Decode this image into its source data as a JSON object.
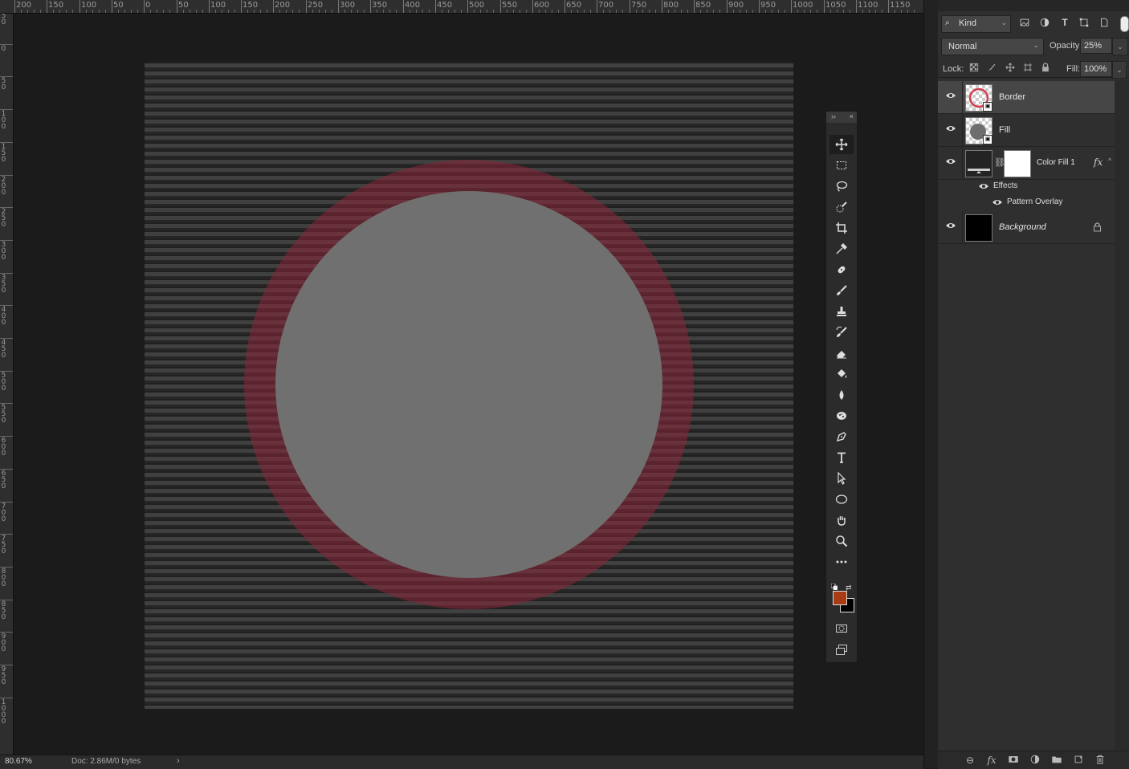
{
  "ruler": {
    "top_labels": [
      "200",
      "150",
      "100",
      "50",
      "0",
      "50",
      "100",
      "150",
      "200",
      "250",
      "300",
      "350",
      "400",
      "450",
      "500",
      "550",
      "600",
      "650",
      "700",
      "750",
      "800",
      "850",
      "900",
      "950",
      "1000",
      "1050",
      "1100",
      "1150"
    ],
    "left_labels": [
      "5\n0",
      "0",
      "5\n0",
      "1\n0\n0",
      "1\n5\n0",
      "2\n0\n0",
      "2\n5\n0",
      "3\n0\n0",
      "3\n5\n0",
      "4\n0\n0",
      "4\n5\n0",
      "5\n0\n0",
      "5\n5\n0",
      "6\n0\n0",
      "6\n5\n0",
      "7\n0\n0",
      "7\n5\n0",
      "8\n0\n0",
      "8\n5\n0",
      "9\n0\n0",
      "9\n5\n0",
      "1\n0\n0\n0"
    ]
  },
  "status": {
    "zoom": "80.67%",
    "doc_info": "Doc: 2.86M/0 bytes",
    "arrow": "›"
  },
  "tools": {
    "header_collapse": "››",
    "header_close": "×",
    "items": [
      {
        "name": "move-tool",
        "icon": "move-icon",
        "active": true
      },
      {
        "name": "rectangular-marquee-tool",
        "icon": "marquee-icon"
      },
      {
        "name": "lasso-tool",
        "icon": "lasso-icon"
      },
      {
        "name": "quick-selection-tool",
        "icon": "quick-selection-icon"
      },
      {
        "name": "crop-tool",
        "icon": "crop-icon"
      },
      {
        "name": "eyedropper-tool",
        "icon": "eyedropper-icon"
      },
      {
        "name": "healing-brush-tool",
        "icon": "bandage-icon"
      },
      {
        "name": "brush-tool",
        "icon": "brush-icon"
      },
      {
        "name": "clone-stamp-tool",
        "icon": "stamp-icon"
      },
      {
        "name": "history-brush-tool",
        "icon": "history-brush-icon"
      },
      {
        "name": "eraser-tool",
        "icon": "eraser-icon"
      },
      {
        "name": "paint-bucket-tool",
        "icon": "paint-bucket-icon"
      },
      {
        "name": "blur-tool",
        "icon": "drop-icon"
      },
      {
        "name": "dodge-tool",
        "icon": "sponge-icon"
      },
      {
        "name": "pen-tool",
        "icon": "pen-icon"
      },
      {
        "name": "type-tool",
        "icon": "type-icon"
      },
      {
        "name": "path-selection-tool",
        "icon": "arrow-icon"
      },
      {
        "name": "ellipse-tool",
        "icon": "ellipse-icon"
      },
      {
        "name": "hand-tool",
        "icon": "hand-icon"
      },
      {
        "name": "zoom-tool",
        "icon": "zoom-icon"
      },
      {
        "name": "edit-toolbar",
        "icon": "more-icon"
      }
    ],
    "foreground_color": "#a83c14",
    "background_color": "#000000",
    "quick_mask_icon": "quick-mask-icon",
    "screen_mode_icon": "screen-mode-icon"
  },
  "layers_panel": {
    "filter_kind": "Kind",
    "blend_mode": "Normal",
    "opacity_label": "Opacity:",
    "opacity_value": "25%",
    "lock_label": "Lock:",
    "fill_label": "Fill:",
    "fill_value": "100%",
    "layers": [
      {
        "name": "Border",
        "selected": true,
        "italic": false
      },
      {
        "name": "Fill",
        "selected": false,
        "italic": false
      },
      {
        "name": "Color Fill 1",
        "selected": false,
        "italic": false,
        "fx": "fx"
      },
      {
        "name": "Background",
        "selected": false,
        "italic": true
      }
    ],
    "effects_label": "Effects",
    "effect_item": "Pattern Overlay"
  },
  "colors": {
    "ring": "#8a2438",
    "fill_circle": "#707070",
    "accent_swatch": "#a83c14"
  }
}
